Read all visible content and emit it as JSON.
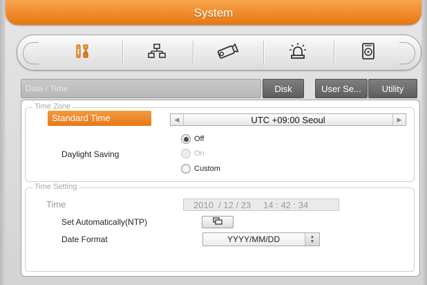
{
  "window": {
    "title": "System"
  },
  "toolbar": {
    "items": [
      {
        "name": "tools-icon",
        "accent": "#e07a10"
      },
      {
        "name": "network-icon"
      },
      {
        "name": "camera-icon"
      },
      {
        "name": "alarm-icon"
      },
      {
        "name": "disk-icon"
      }
    ]
  },
  "tabs": {
    "active": "Date / Time",
    "items": [
      "Disk",
      "User Se...",
      "Utility"
    ]
  },
  "time_zone": {
    "legend": "Time Zone",
    "standard_time_label": "Standard Time",
    "value": "UTC +09:00 Seoul",
    "daylight_label": "Daylight Saving",
    "options": [
      {
        "label": "Off",
        "selected": true,
        "enabled": true
      },
      {
        "label": "On",
        "selected": false,
        "enabled": false
      },
      {
        "label": "Custom",
        "selected": false,
        "enabled": true
      }
    ]
  },
  "time_setting": {
    "legend": "Time Setting",
    "time_label": "Time",
    "time_value": "2010  / 12 / 23     14 : 42 : 34",
    "ntp_label": "Set Automatically(NTP)",
    "date_format_label": "Date Format",
    "date_format_value": "YYYY/MM/DD"
  },
  "colors": {
    "accent": "#f08a2a",
    "tab_dark": "#6a6a6a"
  }
}
